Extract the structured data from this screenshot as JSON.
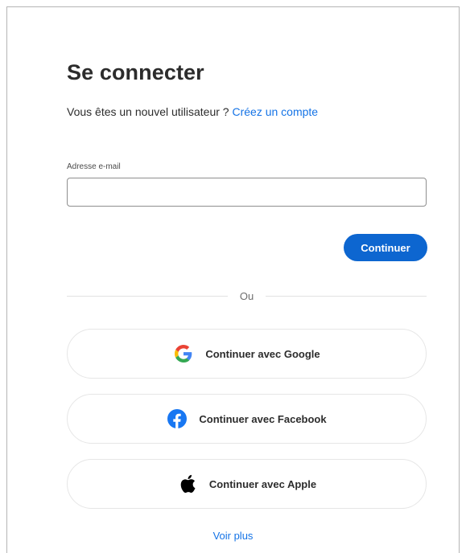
{
  "signin": {
    "title": "Se connecter",
    "subtitle_prefix": "Vous êtes un nouvel utilisateur ? ",
    "create_account_link": "Créez un compte",
    "email_label": "Adresse e-mail",
    "email_value": "",
    "continue_label": "Continuer",
    "or_text": "Ou",
    "social": [
      {
        "label": "Continuer avec Google",
        "icon": "google-icon"
      },
      {
        "label": "Continuer avec Facebook",
        "icon": "facebook-icon"
      },
      {
        "label": "Continuer avec Apple",
        "icon": "apple-icon"
      }
    ],
    "see_more_label": "Voir plus"
  },
  "colors": {
    "accent": "#0d66d0",
    "link": "#1473e6",
    "facebook": "#1877f2"
  }
}
